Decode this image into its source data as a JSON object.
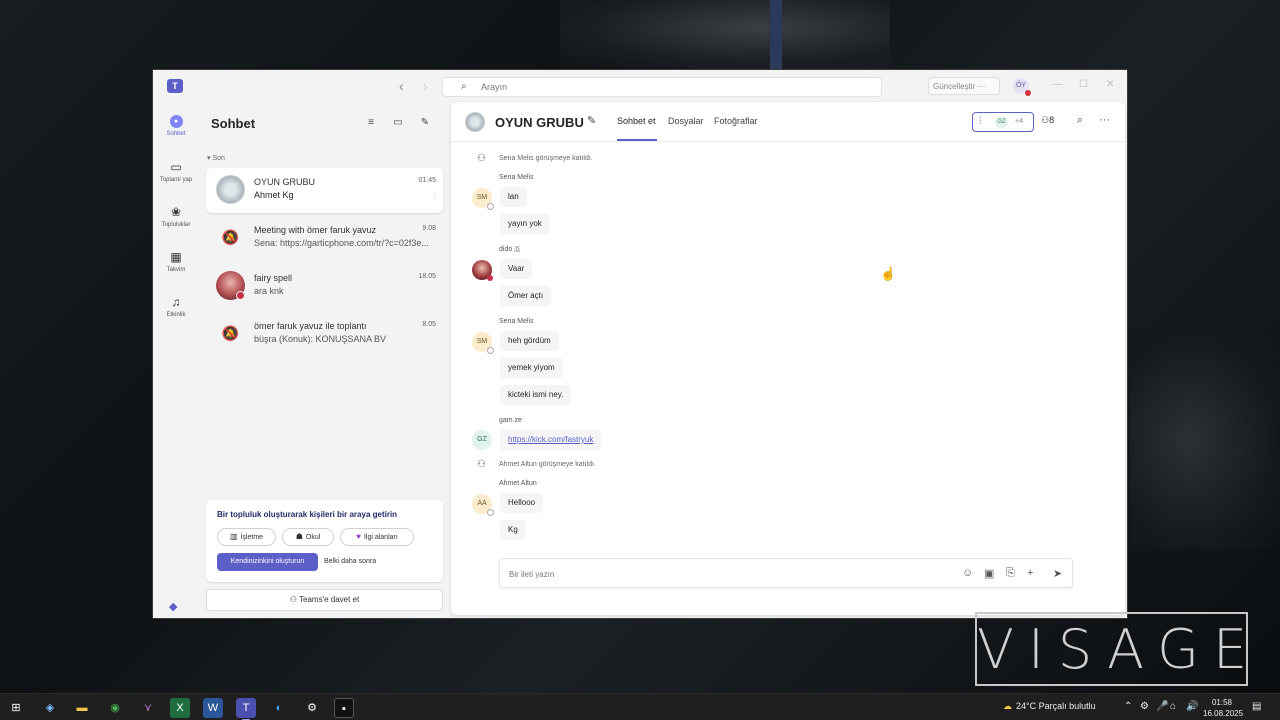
{
  "window": {
    "search_placeholder": "Arayın",
    "update_label": "Güncelleştir  ···",
    "user_initials": "ÖY"
  },
  "rail": [
    {
      "label": "Sohbet",
      "icon": "chat-icon"
    },
    {
      "label": "Toplantı yap",
      "icon": "video-icon"
    },
    {
      "label": "Topluluklar",
      "icon": "communities-icon"
    },
    {
      "label": "Takvim",
      "icon": "calendar-icon"
    },
    {
      "label": "Etkinlik",
      "icon": "bell-icon"
    }
  ],
  "chat_list": {
    "title": "Sohbet",
    "section": "Son",
    "items": [
      {
        "name": "OYUN GRUBU",
        "preview": "Ahmet Kg",
        "time": "01:45"
      },
      {
        "name": "Meeting with ömer faruk yavuz",
        "preview": "Sena: https://garticphone.com/tr/?c=02f3e...",
        "time": "9.08"
      },
      {
        "name": "fairy spell",
        "preview": "ara knk",
        "time": "18.05"
      },
      {
        "name": "ömer faruk yavuz ile toplantı",
        "preview": "büşra (Konuk): KONUŞSANA BV",
        "time": "8.05"
      }
    ],
    "community": {
      "title": "Bir topluluk oluşturarak kişileri bir araya getirin",
      "pills": [
        "İşletme",
        "Okul",
        "İlgi alanları"
      ],
      "primary": "Kendinizinkini oluşturun",
      "later": "Belki daha sonra"
    },
    "invite": "Teams'e davet et"
  },
  "conversation": {
    "title": "OYUN GRUBU",
    "tabs": [
      "Sohbet et",
      "Dosyalar",
      "Fotoğraflar"
    ],
    "call_initials": "GZ",
    "call_more": "+4",
    "participants": "8",
    "messages": {
      "sys1": "Sena Melis görüşmeye katıldı.",
      "sender1": "Sena Melis",
      "initials1": "SM",
      "m1a": "lan",
      "m1b": "yayın yok",
      "sender2": "dido 🇩",
      "m2a": "Vaar",
      "m2b": "Ömer açtı",
      "sender3": "Sena Melis",
      "initials3": "SM",
      "m3a": "heh gördüm",
      "m3b": "yemek yiyom",
      "m3c": "kicteki ismi ney.",
      "sender4": "gam ze",
      "initials4": "GZ",
      "m4a": "https://kick.com/fastryuk",
      "sys2": "Ahmet Altun görüşmeye katıldı.",
      "sender5": "Ahmet Altun",
      "initials5": "AA",
      "m5a": "Hellooo",
      "m5b": "Kg"
    },
    "composer_placeholder": "Bir ileti yazın"
  },
  "watermark": "VISAGE",
  "taskbar": {
    "weather": "24°C  Parçalı bulutlu",
    "time": "01:58",
    "date": "16.08.2025"
  }
}
